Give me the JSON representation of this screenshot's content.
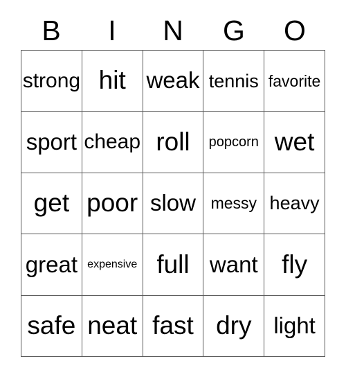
{
  "card": {
    "title": "BINGO",
    "header": {
      "letters": [
        "B",
        "I",
        "N",
        "G",
        "O"
      ]
    },
    "colors": {
      "background": "#ffffff",
      "text": "#000000",
      "grid_line": "#5a5a5a"
    },
    "grid": {
      "columns": 5,
      "rows": 5,
      "cells": [
        [
          {
            "word": "strong",
            "size": "md"
          },
          {
            "word": "hit",
            "size": "xl"
          },
          {
            "word": "weak",
            "size": "lg"
          },
          {
            "word": "tennis",
            "size": "sm"
          },
          {
            "word": "favorite",
            "size": "xs"
          }
        ],
        [
          {
            "word": "sport",
            "size": "lg"
          },
          {
            "word": "cheap",
            "size": "md"
          },
          {
            "word": "roll",
            "size": "xl"
          },
          {
            "word": "popcorn",
            "size": "xxs"
          },
          {
            "word": "wet",
            "size": "xl"
          }
        ],
        [
          {
            "word": "get",
            "size": "xl"
          },
          {
            "word": "poor",
            "size": "xl"
          },
          {
            "word": "slow",
            "size": "lg"
          },
          {
            "word": "messy",
            "size": "xs"
          },
          {
            "word": "heavy",
            "size": "sm"
          }
        ],
        [
          {
            "word": "great",
            "size": "lg"
          },
          {
            "word": "expensive",
            "size": "tiny"
          },
          {
            "word": "full",
            "size": "xl"
          },
          {
            "word": "want",
            "size": "lg"
          },
          {
            "word": "fly",
            "size": "xl"
          }
        ],
        [
          {
            "word": "safe",
            "size": "xl"
          },
          {
            "word": "neat",
            "size": "xl"
          },
          {
            "word": "fast",
            "size": "xl"
          },
          {
            "word": "dry",
            "size": "xl"
          },
          {
            "word": "light",
            "size": "lg"
          }
        ]
      ]
    }
  }
}
